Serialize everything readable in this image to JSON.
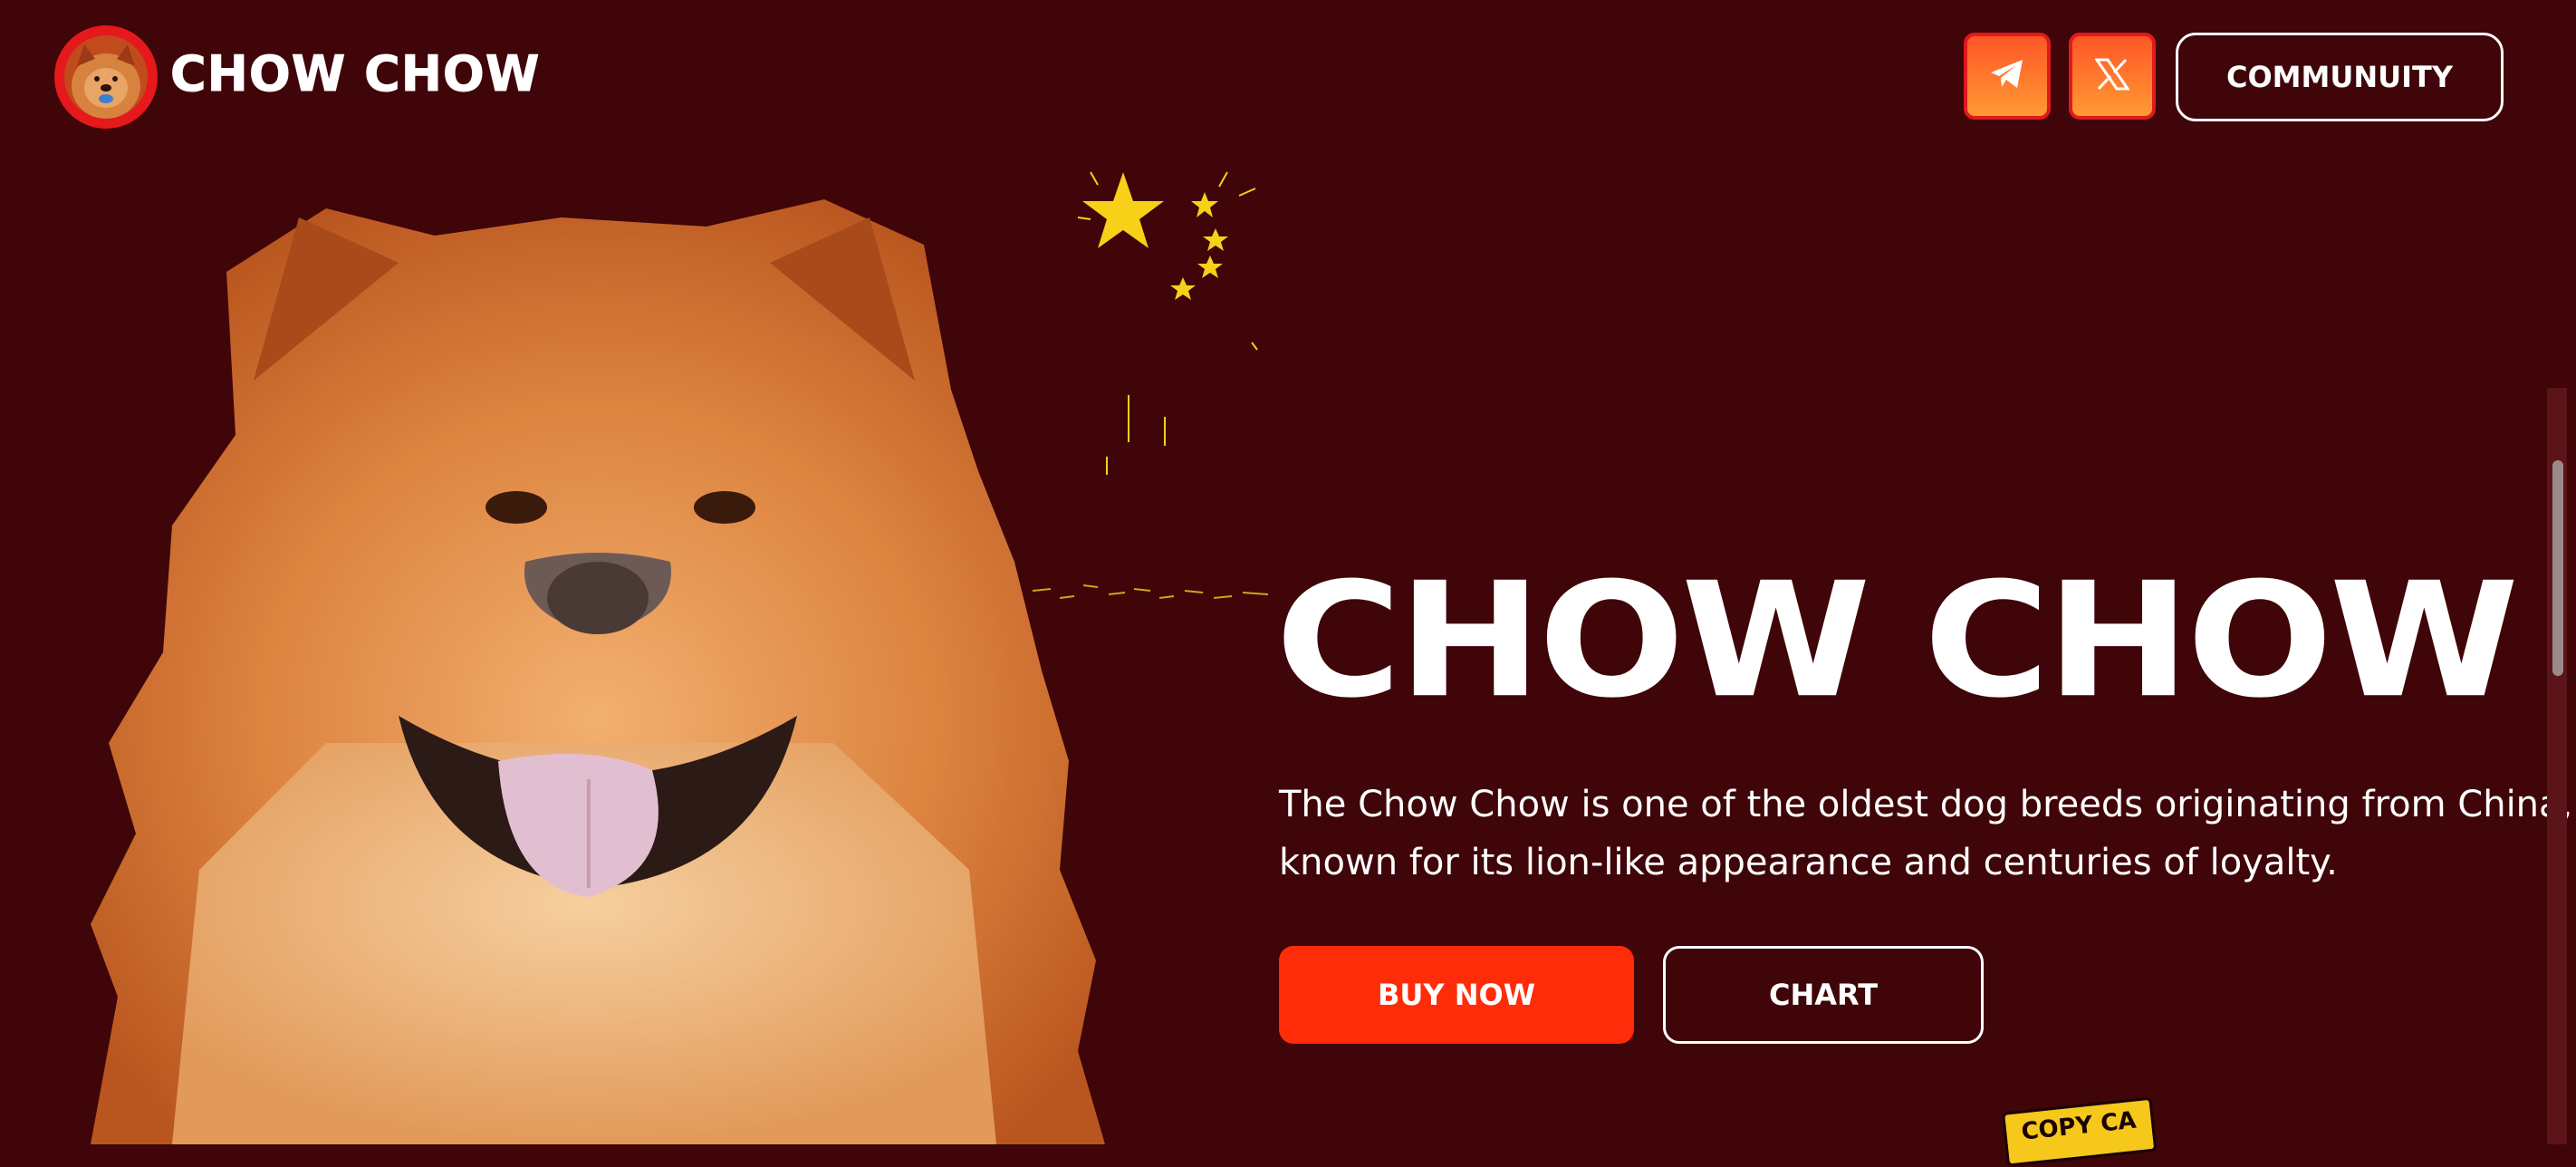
{
  "header": {
    "brand": "CHOW CHOW",
    "logo_icon": "chow-chow-avatar",
    "social": [
      {
        "name": "telegram",
        "icon": "telegram-icon"
      },
      {
        "name": "x",
        "icon": "x-icon"
      }
    ],
    "community_label": "COMMUNUITY"
  },
  "hero": {
    "title": "CHOW CHOW",
    "description": "The Chow Chow is one of the oldest dog breeds originating from China, known for its lion-like appearance and centuries of loyalty.",
    "buy_label": "BUY NOW",
    "chart_label": "CHART",
    "copy_ca_label": "COPY CA"
  },
  "colors": {
    "background": "#3f0508",
    "accent": "#ff2c09",
    "social_gradient_top": "#ff5628",
    "social_gradient_bottom": "#ff9a33",
    "star": "#f7d117",
    "copy_ca": "#f5c81b"
  }
}
